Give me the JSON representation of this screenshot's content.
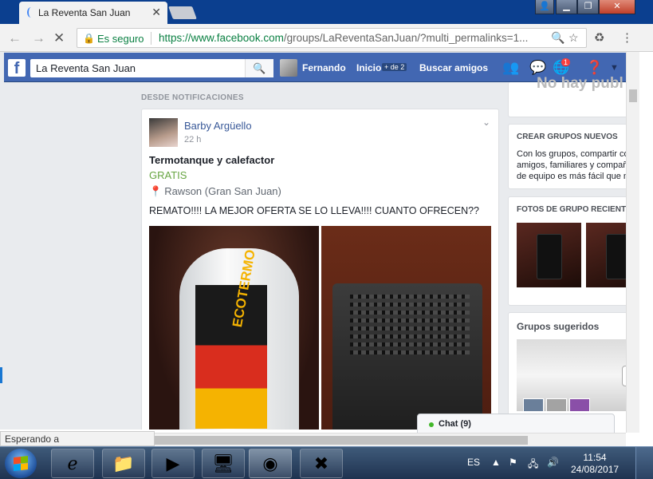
{
  "browser": {
    "tab_title": "La Reventa San Juan",
    "tab_close": "✕",
    "secure_label": "Es seguro",
    "url_host": "https://www.facebook.com",
    "url_path": "/groups/LaReventaSanJuan/?multi_permalinks=1...",
    "status_text": "Esperando a www.facebook.com..."
  },
  "facebook": {
    "search_value": "La Reventa San Juan",
    "user_name": "Fernando",
    "nav_home": "Inicio",
    "home_badge": "+ de 2",
    "nav_find_friends": "Buscar amigos",
    "notif_count": "1",
    "nohay_text": "No hay publ"
  },
  "feed": {
    "section_label": "DESDE NOTIFICACIONES",
    "post": {
      "author": "Barby Argüello",
      "time": "22 h",
      "title": "Termotanque y calefactor",
      "price": "GRATIS",
      "location": "Rawson (Gran San Juan)",
      "text": "REMATO!!!! LA MEJOR OFERTA SE LO LLEVA!!!! CUANTO OFRECEN??",
      "photo1_brand": "ECOTERMO"
    }
  },
  "right_column": {
    "create_groups_title": "CREAR GRUPOS NUEVOS",
    "create_groups_lines": [
      "Con los grupos, compartir co",
      "amigos, familiares y compañe",
      "de equipo es más fácil que nu"
    ],
    "group_photos_title": "FOTOS DE GRUPO RECIENTE",
    "suggested_title": "Grupos sugeridos"
  },
  "chat": {
    "label": "Chat (9)"
  },
  "taskbar": {
    "lang": "ES",
    "time": "11:54",
    "date": "24/08/2017"
  },
  "colors": {
    "facebook_blue": "#4267b2",
    "link_blue": "#385898",
    "price_green": "#67a542",
    "secure_green": "#0b8043"
  }
}
